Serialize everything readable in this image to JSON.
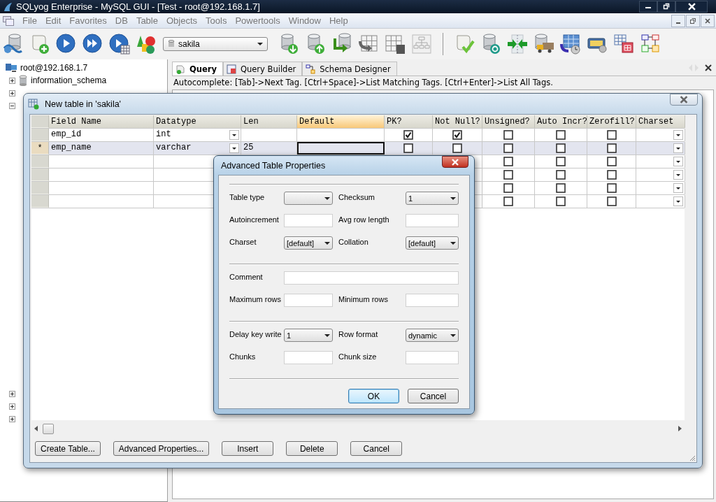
{
  "window": {
    "title": "SQLyog Enterprise - MySQL GUI - [Test - root@192.168.1.7]"
  },
  "menu": [
    "File",
    "Edit",
    "Favorites",
    "DB",
    "Table",
    "Objects",
    "Tools",
    "Powertools",
    "Window",
    "Help"
  ],
  "toolbar": {
    "database": "sakila"
  },
  "tree": {
    "root": "root@192.168.1.7",
    "items": [
      {
        "label": "information_schema",
        "expanded": false
      },
      {
        "expanded": false
      },
      {
        "expanded": true
      },
      {
        "expanded": false
      },
      {
        "expanded": false
      },
      {
        "expanded": false
      }
    ]
  },
  "tabs": [
    {
      "label": "Query",
      "selected": true
    },
    {
      "label": "Query Builder",
      "selected": false
    },
    {
      "label": "Schema Designer",
      "selected": false
    }
  ],
  "hint": "Autocomplete: [Tab]->Next Tag. [Ctrl+Space]->List Matching Tags. [Ctrl+Enter]->List All Tags.",
  "new_table": {
    "title": "New table in 'sakila'",
    "columns": [
      {
        "label": "Field Name",
        "kind": "text",
        "selected": false
      },
      {
        "label": "Datatype",
        "kind": "select",
        "selected": false
      },
      {
        "label": "Len",
        "kind": "text",
        "selected": false
      },
      {
        "label": "Default",
        "kind": "text",
        "selected": true
      },
      {
        "label": "PK?",
        "kind": "check",
        "selected": false
      },
      {
        "label": "Not Null?",
        "kind": "check",
        "selected": false
      },
      {
        "label": "Unsigned?",
        "kind": "check",
        "selected": false
      },
      {
        "label": "Auto Incr?",
        "kind": "check",
        "selected": false
      },
      {
        "label": "Zerofill?",
        "kind": "check",
        "selected": false
      },
      {
        "label": "Charset",
        "kind": "select",
        "selected": false
      }
    ],
    "rows": [
      {
        "selected": false,
        "cells": [
          {
            "value": "emp_id"
          },
          {
            "value": "int",
            "dropdown": true
          },
          {},
          {},
          {
            "checked": true
          },
          {
            "checked": true
          },
          {
            "checked": false
          },
          {
            "checked": false
          },
          {
            "checked": false
          },
          {
            "dropdown": true
          }
        ]
      },
      {
        "selected": true,
        "marker": "*",
        "cells": [
          {
            "value": "emp_name"
          },
          {
            "value": "varchar",
            "dropdown": true
          },
          {
            "value": "25"
          },
          {
            "focused": true
          },
          {
            "checked": false
          },
          {
            "checked": false
          },
          {
            "checked": false
          },
          {
            "checked": false
          },
          {
            "checked": false
          },
          {
            "dropdown": true
          }
        ]
      },
      {
        "selected": false,
        "cells": [
          {},
          {},
          {},
          {},
          {},
          {},
          {
            "checked": false
          },
          {
            "checked": false
          },
          {
            "checked": false
          },
          {
            "dropdown": true
          }
        ]
      },
      {
        "selected": false,
        "cells": [
          {},
          {},
          {},
          {},
          {},
          {},
          {
            "checked": false
          },
          {
            "checked": false
          },
          {
            "checked": false
          },
          {
            "dropdown": true
          }
        ]
      },
      {
        "selected": false,
        "cells": [
          {},
          {},
          {},
          {},
          {},
          {},
          {
            "checked": false
          },
          {
            "checked": false
          },
          {
            "checked": false
          },
          {
            "dropdown": true
          }
        ]
      },
      {
        "selected": false,
        "cells": [
          {},
          {},
          {},
          {},
          {},
          {},
          {
            "checked": false
          },
          {
            "checked": false
          },
          {
            "checked": false
          },
          {
            "dropdown": true
          }
        ]
      }
    ],
    "buttons": [
      "Create Table...",
      "Advanced Properties...",
      "Insert",
      "Delete",
      "Cancel"
    ]
  },
  "dialog": {
    "title": "Advanced Table Properties",
    "sections": [
      [
        [
          {
            "label": "Table type",
            "kind": "select"
          },
          {
            "label": "Checksum",
            "kind": "select",
            "value": "1"
          }
        ],
        [
          {
            "label": "Autoincrement",
            "kind": "input"
          },
          {
            "label": "Avg row length",
            "kind": "input"
          }
        ],
        [
          {
            "label": "Charset",
            "kind": "select",
            "value": "[default]"
          },
          {
            "label": "Collation",
            "kind": "select",
            "value": "[default]"
          }
        ]
      ],
      [
        [
          {
            "label": "Comment",
            "kind": "input"
          }
        ],
        [
          {
            "label": "Maximum rows",
            "kind": "input"
          },
          {
            "label": "Minimum rows",
            "kind": "input"
          }
        ]
      ],
      [
        [
          {
            "label": "Delay key write",
            "kind": "select",
            "value": "1"
          },
          {
            "label": "Row format",
            "kind": "select",
            "value": "dynamic"
          }
        ],
        [
          {
            "label": "Chunks",
            "kind": "input"
          },
          {
            "label": "Chunk size",
            "kind": "input"
          }
        ]
      ]
    ],
    "buttons": [
      {
        "label": "OK",
        "default": true
      },
      {
        "label": "Cancel",
        "default": false
      }
    ]
  }
}
